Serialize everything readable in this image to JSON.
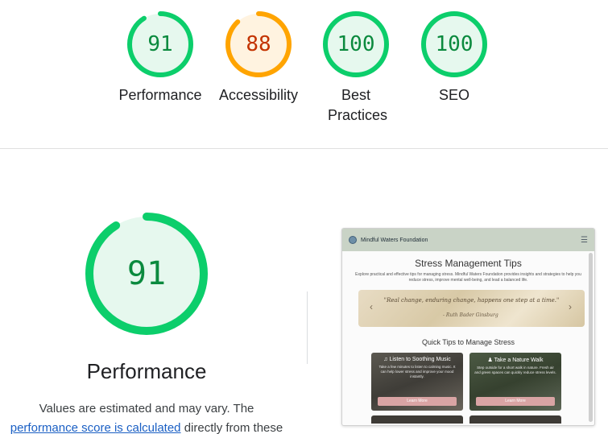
{
  "categories": [
    {
      "label": "Performance",
      "score": "91",
      "value": 91,
      "status": "pass"
    },
    {
      "label": "Accessibility",
      "score": "88",
      "value": 88,
      "status": "average"
    },
    {
      "label": "Best Practices",
      "score": "100",
      "value": 100,
      "status": "pass"
    },
    {
      "label": "SEO",
      "score": "100",
      "value": 100,
      "status": "pass"
    }
  ],
  "colors": {
    "pass_ring": "#0cce6b",
    "pass_fill": "#e6f8ee",
    "pass_text": "#0b8a3e",
    "average_ring": "#ffa400",
    "average_fill": "#fff3e0",
    "average_text": "#c33300",
    "link": "#1a5fc4"
  },
  "main": {
    "score": "91",
    "value": 91,
    "title": "Performance",
    "desc_prefix": "Values are estimated and may vary. The",
    "desc_link": "performance score is calculated",
    "desc_suffix": "directly from these"
  },
  "screenshot": {
    "brand": "Mindful Waters Foundation",
    "menu_icon": "hamburger-icon",
    "heading": "Stress Management Tips",
    "subtitle": "Explore practical and effective tips for managing stress. Mindful Waters Foundation provides insights and strategies to help you reduce stress, improve mental well-being, and lead a balanced life.",
    "quote": "\"Real change, enduring change, happens one step at a time.\"",
    "quote_author": "- Ruth Bader Ginsburg",
    "section_title": "Quick Tips to Manage Stress",
    "cards": [
      {
        "title": "♫ Listen to Soothing Music",
        "text": "Take a few minutes to listen to calming music. It can help lower stress and improve your mood instantly.",
        "button": "Learn More"
      },
      {
        "title": "♟ Take a Nature Walk",
        "text": "Step outside for a short walk in nature. Fresh air and green spaces can quickly reduce stress levels.",
        "button": "Learn More"
      }
    ]
  }
}
